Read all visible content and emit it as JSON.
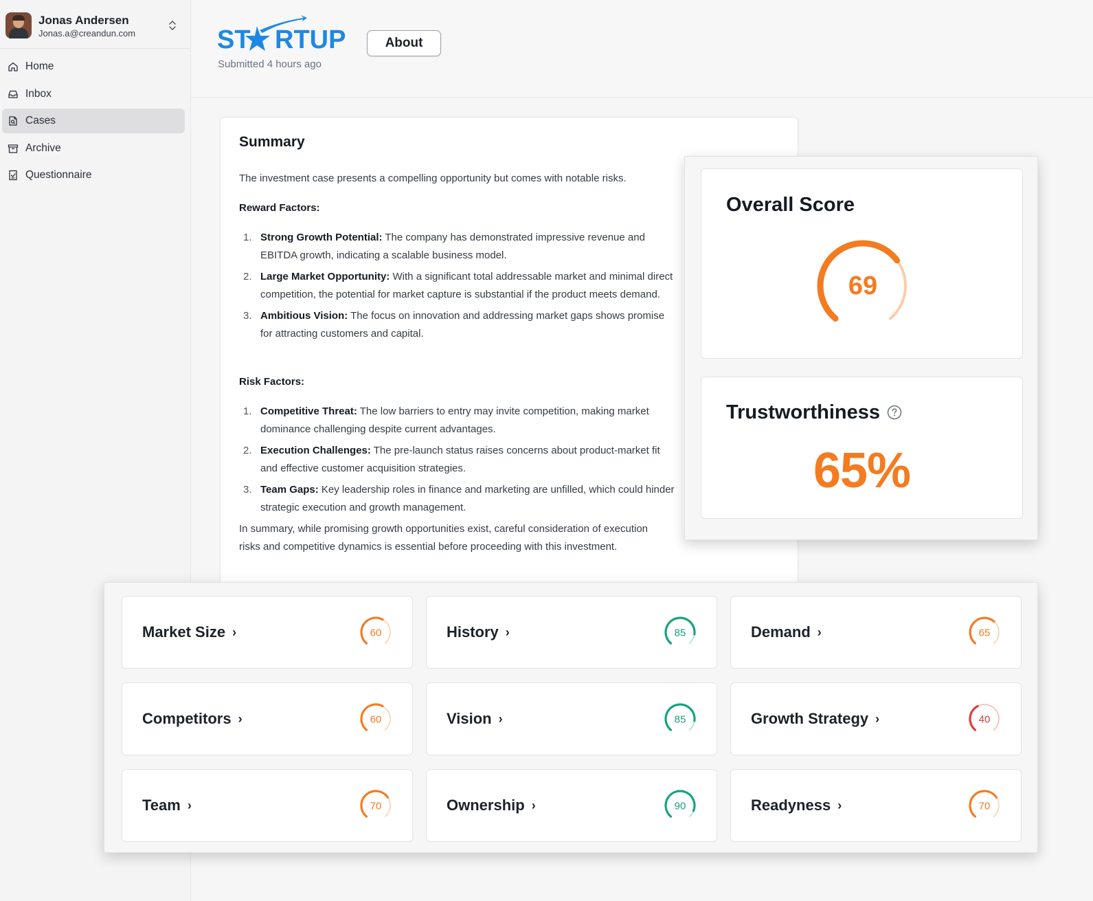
{
  "user": {
    "name": "Jonas Andersen",
    "email": "Jonas.a@creandun.com"
  },
  "nav": [
    {
      "label": "Home",
      "icon": "home-icon",
      "active": false
    },
    {
      "label": "Inbox",
      "icon": "inbox-icon",
      "active": false
    },
    {
      "label": "Cases",
      "icon": "cases-icon",
      "active": true
    },
    {
      "label": "Archive",
      "icon": "archive-icon",
      "active": false
    },
    {
      "label": "Questionnaire",
      "icon": "questionnaire-icon",
      "active": false
    }
  ],
  "header": {
    "logo_text": "STARTUP",
    "submitted": "Submitted 4 hours ago",
    "about_label": "About"
  },
  "summary": {
    "title": "Summary",
    "intro": "The investment case presents a compelling opportunity but comes with notable risks.",
    "reward_heading": "Reward Factors:",
    "reward_items": [
      {
        "num": "1.",
        "title": "Strong Growth Potential:",
        "text": " The company has demonstrated impressive revenue and EBITDA growth, indicating a scalable business model."
      },
      {
        "num": "2.",
        "title": "Large Market Opportunity:",
        "text": " With a significant total addressable market and minimal direct competition, the potential for market capture is substantial if the product meets demand."
      },
      {
        "num": "3.",
        "title": "Ambitious Vision:",
        "text": " The focus on innovation and addressing market gaps shows promise for attracting customers and capital."
      }
    ],
    "risk_heading": "Risk Factors:",
    "risk_items": [
      {
        "num": "1.",
        "title": "Competitive Threat:",
        "text": " The low barriers to entry may invite competition, making market dominance challenging despite current advantages."
      },
      {
        "num": "2.",
        "title": "Execution Challenges:",
        "text": " The pre-launch status raises concerns about product-market fit and effective customer acquisition strategies."
      },
      {
        "num": "3.",
        "title": "Team Gaps:",
        "text": " Key leadership roles in finance and marketing are unfilled, which could hinder strategic execution and growth management."
      }
    ],
    "conclusion": "In summary, while promising growth opportunities exist, careful consideration of execution risks and competitive dynamics is essential before proceeding with this investment."
  },
  "overall": {
    "title": "Overall Score",
    "value": "69",
    "score": 69,
    "color": "#f47b20"
  },
  "trust": {
    "title": "Trustworthiness",
    "value": "65%"
  },
  "categories": [
    {
      "label": "Market Size",
      "value": "60",
      "score": 60,
      "color": "#f47b20"
    },
    {
      "label": "History",
      "value": "85",
      "score": 85,
      "color": "#16a37f"
    },
    {
      "label": "Demand",
      "value": "65",
      "score": 65,
      "color": "#f47b20"
    },
    {
      "label": "Competitors",
      "value": "60",
      "score": 60,
      "color": "#f47b20"
    },
    {
      "label": "Vision",
      "value": "85",
      "score": 85,
      "color": "#16a37f"
    },
    {
      "label": "Growth Strategy",
      "value": "40",
      "score": 40,
      "color": "#e03b3b"
    },
    {
      "label": "Team",
      "value": "70",
      "score": 70,
      "color": "#f47b20"
    },
    {
      "label": "Ownership",
      "value": "90",
      "score": 90,
      "color": "#16a37f"
    },
    {
      "label": "Readyness",
      "value": "70",
      "score": 70,
      "color": "#f47b20"
    }
  ],
  "colors": {
    "accent": "#f47b20",
    "good": "#16a37f",
    "bad": "#e03b3b",
    "brand": "#1e88e5"
  }
}
